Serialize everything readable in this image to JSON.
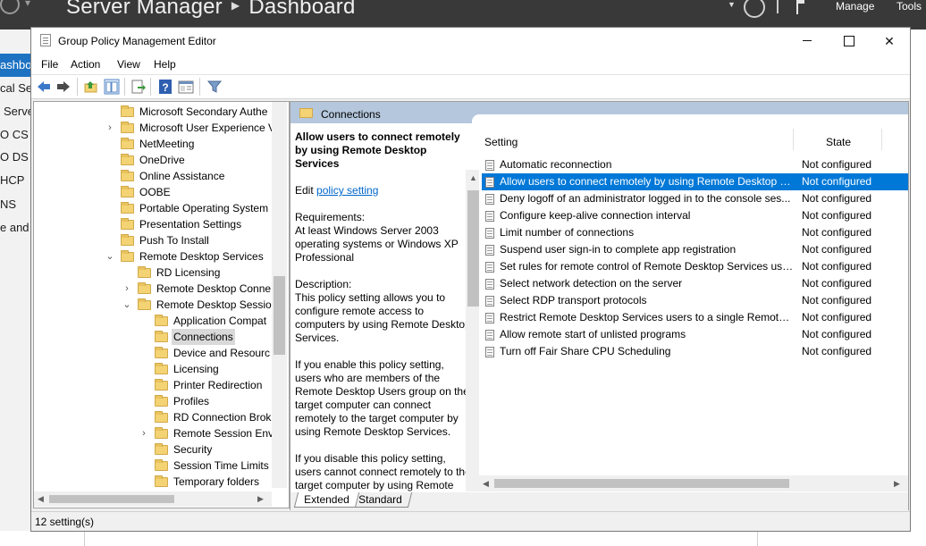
{
  "server_manager": {
    "title": "Server Manager",
    "breadcrumb": "Dashboard",
    "manage_label": "Manage",
    "tools_label": "Tools",
    "left_items": [
      "ashboa",
      "cal Se",
      "Serve",
      "O CS",
      "O DS",
      "HCP",
      "NS",
      "e and"
    ]
  },
  "window": {
    "title": "Group Policy Management Editor",
    "minimize_icon": "minimize-icon",
    "maximize_icon": "maximize-icon",
    "close_glyph": "✕"
  },
  "menu": {
    "file": "File",
    "action": "Action",
    "view": "View",
    "help": "Help"
  },
  "toolbar": {
    "icons": [
      "back-icon",
      "forward-icon",
      "up-folder-icon",
      "show-hide-tree-icon",
      "export-list-icon",
      "help-icon",
      "properties-icon",
      "filter-icon"
    ]
  },
  "tree": {
    "items": [
      {
        "label": "Microsoft Secondary Authe",
        "expander": ""
      },
      {
        "label": "Microsoft User Experience V",
        "expander": "›"
      },
      {
        "label": "NetMeeting",
        "expander": ""
      },
      {
        "label": "OneDrive",
        "expander": ""
      },
      {
        "label": "Online Assistance",
        "expander": ""
      },
      {
        "label": "OOBE",
        "expander": ""
      },
      {
        "label": "Portable Operating System",
        "expander": ""
      },
      {
        "label": "Presentation Settings",
        "expander": ""
      },
      {
        "label": "Push To Install",
        "expander": ""
      },
      {
        "label": "Remote Desktop Services",
        "expander": "⌄"
      },
      {
        "label": "RD Licensing",
        "expander": ""
      },
      {
        "label": "Remote Desktop Conne",
        "expander": "›"
      },
      {
        "label": "Remote Desktop Sessio",
        "expander": "⌄"
      },
      {
        "label": "Application Compat",
        "expander": ""
      },
      {
        "label": "Connections",
        "expander": ""
      },
      {
        "label": "Device and Resourc",
        "expander": ""
      },
      {
        "label": "Licensing",
        "expander": ""
      },
      {
        "label": "Printer Redirection",
        "expander": ""
      },
      {
        "label": "Profiles",
        "expander": ""
      },
      {
        "label": "RD Connection Brok",
        "expander": ""
      },
      {
        "label": "Remote Session Env",
        "expander": "›"
      },
      {
        "label": "Security",
        "expander": ""
      },
      {
        "label": "Session Time Limits",
        "expander": ""
      },
      {
        "label": "Temporary folders",
        "expander": ""
      }
    ],
    "selected": "Connections"
  },
  "details": {
    "header": "Connections",
    "description": {
      "title": "Allow users to connect remotely by using Remote Desktop Services",
      "edit_prefix": "Edit ",
      "edit_link": "policy setting ",
      "requirements_label": "Requirements:",
      "requirements_text": "At least Windows Server 2003 operating systems or Windows XP Professional",
      "description_label": "Description:",
      "description_text": "This policy setting allows you to configure remote access to computers by using Remote Desktop Services.",
      "enable_text": "If you enable this policy setting, users who are members of the Remote Desktop Users group on the target computer can connect remotely to the target computer by using Remote Desktop Services.",
      "disable_text": "If you disable this policy setting, users cannot connect remotely to the target computer by using Remote Desktop Services. The"
    },
    "columns": {
      "setting": "Setting",
      "state": "State"
    },
    "rows": [
      {
        "name": "Automatic reconnection",
        "state": "Not configured"
      },
      {
        "name": "Allow users to connect remotely by using Remote Desktop S...",
        "state": "Not configured"
      },
      {
        "name": "Deny logoff of an administrator logged in to the console ses...",
        "state": "Not configured"
      },
      {
        "name": "Configure keep-alive connection interval",
        "state": "Not configured"
      },
      {
        "name": "Limit number of connections",
        "state": "Not configured"
      },
      {
        "name": "Suspend user sign-in to complete app registration",
        "state": "Not configured"
      },
      {
        "name": "Set rules for remote control of Remote Desktop Services use...",
        "state": "Not configured"
      },
      {
        "name": "Select network detection on the server",
        "state": "Not configured"
      },
      {
        "name": "Select RDP transport protocols",
        "state": "Not configured"
      },
      {
        "name": "Restrict Remote Desktop Services users to a single Remote D...",
        "state": "Not configured"
      },
      {
        "name": "Allow remote start of unlisted programs",
        "state": "Not configured"
      },
      {
        "name": "Turn off Fair Share CPU Scheduling",
        "state": "Not configured"
      }
    ],
    "selected_row": 1,
    "tabs": {
      "extended": "Extended",
      "standard": "Standard"
    }
  },
  "status": {
    "text": "12 setting(s)"
  },
  "colors": {
    "selection": "#0078d7",
    "header_band": "#b4c7dc",
    "server_manager_bar": "#393939",
    "dashboard_accent": "#1e72c2"
  }
}
